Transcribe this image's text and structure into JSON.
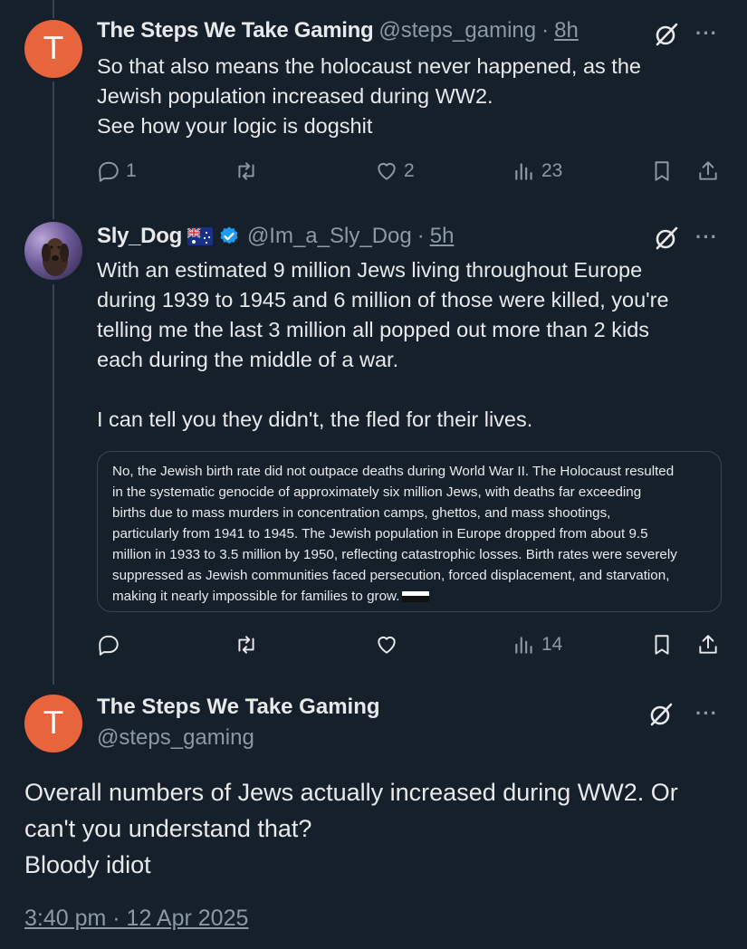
{
  "colors": {
    "background": "#15202b",
    "text": "#e7e9ea",
    "muted": "#8b98a5",
    "avatar": "#e8643c",
    "verified": "#1d9bf0"
  },
  "tweet1": {
    "avatar_letter": "T",
    "name": "The Steps We Take Gaming",
    "handle": "@steps_gaming",
    "separator": "·",
    "time": "8h",
    "text": "So that also means the holocaust never happened, as the\nJewish population increased during WW2.\nSee how your logic is dogshit",
    "replies": "1",
    "likes": "2",
    "views": "23"
  },
  "tweet2": {
    "name": "Sly_Dog",
    "handle": "@Im_a_Sly_Dog",
    "separator": "·",
    "time": "5h",
    "text": "With an estimated 9 million Jews living throughout Europe\nduring 1939 to 1945 and 6 million of those were killed, you're\ntelling me the last 3 million all popped out more than 2 kids\neach during the middle of a war.\n\nI can tell you they didn't, the fled for their lives.",
    "quote": "No, the Jewish birth rate did not outpace deaths during World War II. The Holocaust resulted\nin the systematic genocide of approximately six million Jews, with deaths far exceeding\nbirths due to mass murders in concentration camps, ghettos, and mass shootings,\nparticularly from 1941 to 1945. The Jewish population in Europe dropped from about 9.5\nmillion in 1933 to 3.5 million by 1950, reflecting catastrophic losses. Birth rates were severely\nsuppressed as Jewish communities faced persecution, forced displacement, and starvation,\nmaking it nearly impossible for families to grow.",
    "views": "14"
  },
  "main_tweet": {
    "avatar_letter": "T",
    "name": "The Steps We Take Gaming",
    "handle": "@steps_gaming",
    "text": "Overall numbers of Jews actually increased during WW2. Or\ncan't you understand that?\nBloody idiot",
    "timestamp": "3:40 pm · 12 Apr 2025"
  },
  "icons": {
    "grok": "grok-icon",
    "more": "more-icon",
    "reply": "reply-icon",
    "retweet": "retweet-icon",
    "like": "heart-icon",
    "views": "views-icon",
    "bookmark": "bookmark-icon",
    "share": "share-icon"
  },
  "more_glyph": "···"
}
